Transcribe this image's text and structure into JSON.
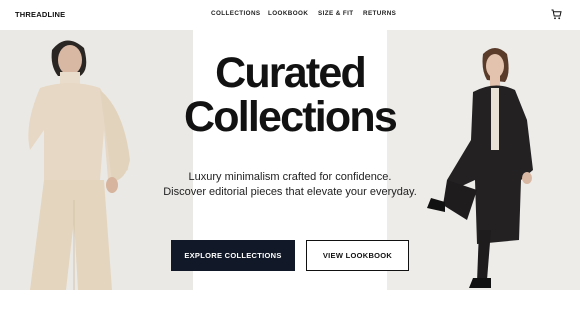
{
  "header": {
    "brand": "THREADLINE",
    "nav": [
      "COLLECTIONS",
      "LOOKBOOK",
      "SIZE & FIT",
      "RETURNS"
    ],
    "cart_icon": "cart-icon"
  },
  "hero": {
    "title_line1": "Curated",
    "title_line2": "Collections",
    "subtitle_line1": "Luxury minimalism crafted for confidence.",
    "subtitle_line2": "Discover editorial pieces that elevate your everyday.",
    "primary_button": "EXPLORE COLLECTIONS",
    "secondary_button": "VIEW LOOKBOOK",
    "left_image": "model-cream-outfit-photo",
    "right_image": "model-black-coat-photo"
  },
  "colors": {
    "primary_button_bg": "#111827",
    "panel_bg": "#e9e7e3"
  }
}
